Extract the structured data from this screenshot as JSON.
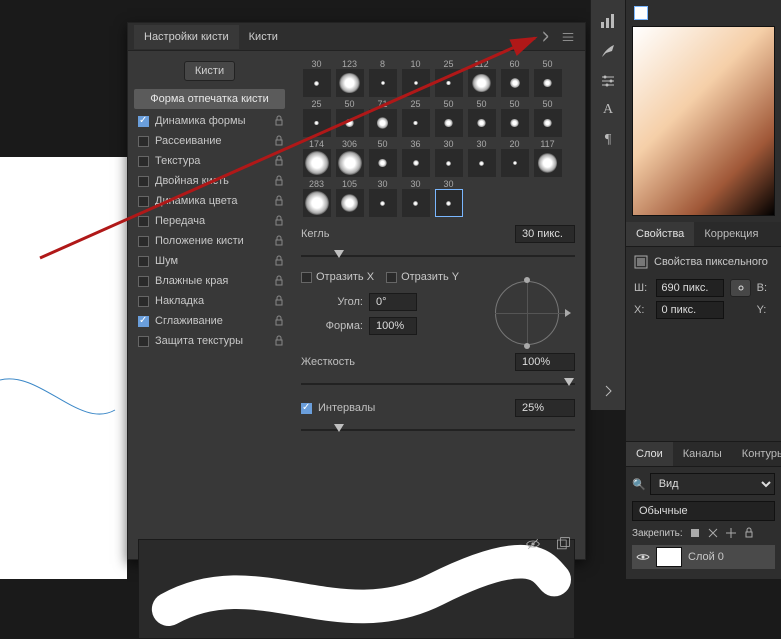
{
  "tabs": {
    "brush_settings": "Настройки кисти",
    "brushes": "Кисти"
  },
  "options_button": "Кисти",
  "shape_header": "Форма отпечатка кисти",
  "options": [
    {
      "label": "Динамика формы",
      "checked": true,
      "lock": true
    },
    {
      "label": "Рассеивание",
      "checked": false,
      "lock": true
    },
    {
      "label": "Текстура",
      "checked": false,
      "lock": true
    },
    {
      "label": "Двойная кисть",
      "checked": false,
      "lock": true
    },
    {
      "label": "Динамика цвета",
      "checked": false,
      "lock": true
    },
    {
      "label": "Передача",
      "checked": false,
      "lock": true
    },
    {
      "label": "Положение кисти",
      "checked": false,
      "lock": true
    },
    {
      "label": "Шум",
      "checked": false,
      "lock": true
    },
    {
      "label": "Влажные края",
      "checked": false,
      "lock": true
    },
    {
      "label": "Накладка",
      "checked": false,
      "lock": true
    },
    {
      "label": "Сглаживание",
      "checked": true,
      "lock": true
    },
    {
      "label": "Защита текстуры",
      "checked": false,
      "lock": true
    }
  ],
  "thumbs_top": [
    "30",
    "123",
    "8",
    "10",
    "25",
    "112",
    "60",
    "50"
  ],
  "thumbs_mid": [
    "25",
    "50",
    "71",
    "25",
    "50",
    "50",
    "50",
    "50"
  ],
  "thumbs_bot": [
    "174",
    "306",
    "50",
    "36",
    "30",
    "30",
    "20",
    "117"
  ],
  "thumbs_extra": [
    "283",
    "105",
    "30",
    "30",
    "30"
  ],
  "selected_index": 4,
  "controls": {
    "size_label": "Кегль",
    "size_value": "30 пикс.",
    "flipx": "Отразить X",
    "flipy": "Отразить Y",
    "angle_label": "Угол:",
    "angle_value": "0°",
    "shape_label": "Форма:",
    "shape_value": "100%",
    "hardness_label": "Жесткость",
    "hardness_value": "100%",
    "spacing_label": "Интервалы",
    "spacing_value": "25%"
  },
  "right_icons": [
    "histogram",
    "brush-options",
    "equalizer",
    "text",
    "paragraph",
    "collapse"
  ],
  "properties": {
    "tab_props": "Свойства",
    "tab_corr": "Коррекция",
    "title": "Свойства пиксельного",
    "w_label": "Ш:",
    "w_value": "690 пикс.",
    "b_label": "В:",
    "x_label": "X:",
    "x_value": "0 пикс.",
    "y_label": "Y:"
  },
  "layers": {
    "tab_layers": "Слои",
    "tab_channels": "Каналы",
    "tab_paths": "Контуры",
    "filter": "Вид",
    "blend": "Обычные",
    "lock_label": "Закрепить:",
    "layer0": "Слой 0"
  },
  "search_icon": "🔍"
}
